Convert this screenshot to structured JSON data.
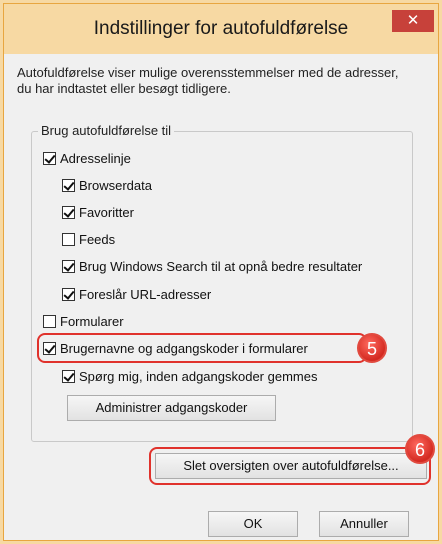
{
  "dialog": {
    "title": "Indstillinger for autofuldførelse",
    "close_label": "✕",
    "description": "Autofuldførelse viser mulige overensstemmelser med de adresser, du har indtastet eller besøgt tidligere.",
    "group_label": "Brug autofuldførelse til"
  },
  "options": {
    "address_bar": {
      "label": "Adresselinje",
      "checked": true
    },
    "browser_data": {
      "label": "Browserdata",
      "checked": true
    },
    "favorites": {
      "label": "Favoritter",
      "checked": true
    },
    "feeds": {
      "label": "Feeds",
      "checked": false
    },
    "windows_search": {
      "label": "Brug Windows Search til at opnå bedre resultater",
      "checked": true
    },
    "suggest_urls": {
      "label": "Foreslår URL-adresser",
      "checked": true
    },
    "forms": {
      "label": "Formularer",
      "checked": false
    },
    "usernames_passwords": {
      "label": "Brugernavne og adgangskoder i formularer",
      "checked": true
    },
    "ask_before_saving": {
      "label": "Spørg mig, inden adgangskoder gemmes",
      "checked": true
    }
  },
  "buttons": {
    "manage_passwords": "Administrer adgangskoder",
    "delete_history": "Slet oversigten over autofuldførelse...",
    "ok": "OK",
    "cancel": "Annuller"
  },
  "annotations": {
    "badge_5": "5",
    "badge_6": "6",
    "highlight_color": "#e0322c"
  }
}
